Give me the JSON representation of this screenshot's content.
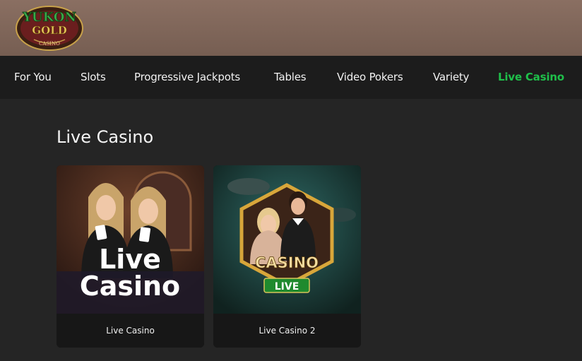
{
  "brand": {
    "line1": "YUKON",
    "line2": "GOLD",
    "line3": "CASINO"
  },
  "nav": {
    "items": [
      {
        "label": "For You"
      },
      {
        "label": "Slots"
      },
      {
        "label": "Progressive Jackpots"
      },
      {
        "label": "Tables"
      },
      {
        "label": "Video Pokers"
      },
      {
        "label": "Variety"
      },
      {
        "label": "Live Casino",
        "active": true
      }
    ]
  },
  "section": {
    "title": "Live Casino"
  },
  "games": [
    {
      "label": "Live Casino",
      "art_line1": "Live",
      "art_line2": "Casino"
    },
    {
      "label": "Live Casino 2",
      "art_badge": "CASINO",
      "art_sub": "LIVE"
    }
  ],
  "colors": {
    "accent": "#1fbf4a",
    "topbar": "#7e6458",
    "nav_bg": "#1c1c1c",
    "page_bg": "#252525"
  }
}
